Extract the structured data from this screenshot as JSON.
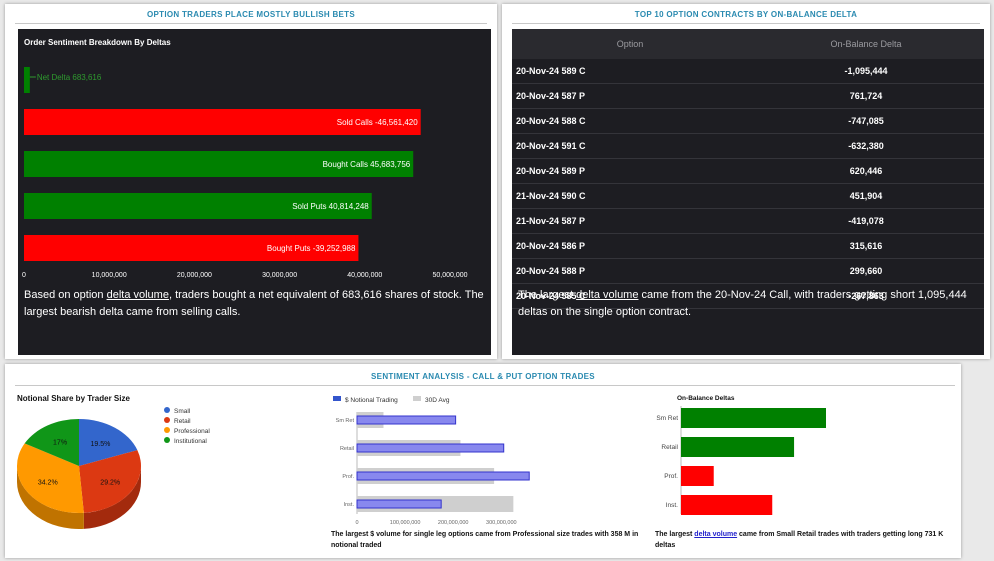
{
  "panels": {
    "left_title": "OPTION TRADERS PLACE MOSTLY BULLISH BETS",
    "right_title": "TOP 10 OPTION CONTRACTS BY ON-BALANCE DELTA",
    "bottom_title": "SENTIMENT ANALYSIS - CALL & PUT OPTION TRADES"
  },
  "order_sentiment": {
    "chart_data": {
      "type": "bar",
      "title": "Order Sentiment Breakdown By Deltas",
      "categories": [
        "Net Delta",
        "Sold Calls",
        "Bought Calls",
        "Sold Puts",
        "Bought Puts"
      ],
      "labels": [
        "Net Delta 683,616",
        "Sold Calls -46,561,420",
        "Bought Calls 45,683,756",
        "Sold Puts 40,814,248",
        "Bought Puts -39,252,988"
      ],
      "values": [
        683616,
        46561420,
        45683756,
        40814248,
        39252988
      ],
      "colors": [
        "#008000",
        "#ff0000",
        "#008000",
        "#008000",
        "#ff0000"
      ],
      "xlim": [
        0,
        50000000
      ],
      "xticks": [
        "0",
        "10,000,000",
        "20,000,000",
        "30,000,000",
        "40,000,000",
        "50,000,000"
      ]
    },
    "note_pre": "Based on option ",
    "note_link": "delta volume",
    "note_post": ", traders bought a net equivalent of 683,616 shares of stock. The largest bearish delta came from selling calls."
  },
  "top10": {
    "headers": [
      "Option",
      "On-Balance Delta"
    ],
    "rows": [
      [
        "20-Nov-24 589 C",
        "-1,095,444"
      ],
      [
        "20-Nov-24 587 P",
        "761,724"
      ],
      [
        "20-Nov-24 588 C",
        "-747,085"
      ],
      [
        "20-Nov-24 591 C",
        "-632,380"
      ],
      [
        "20-Nov-24 589 P",
        "620,446"
      ],
      [
        "21-Nov-24 590 C",
        "451,904"
      ],
      [
        "21-Nov-24 587 P",
        "-419,078"
      ],
      [
        "20-Nov-24 586 P",
        "315,616"
      ],
      [
        "20-Nov-24 588 P",
        "299,660"
      ],
      [
        "20-Nov-24 585 C",
        "-267,863"
      ]
    ],
    "note_pre": "The largest ",
    "note_link": "delta volume",
    "note_post": " came from the 20-Nov-24 Call, with traders getting short 1,095,444 deltas on the single option contract."
  },
  "notional_share": {
    "chart_data": {
      "type": "pie",
      "title": "Notional Share by Trader Size",
      "labels": [
        "Small",
        "Retail",
        "Professional",
        "Institutional"
      ],
      "values": [
        19.5,
        29.2,
        34.2,
        17
      ],
      "value_labels": [
        "19.5%",
        "29.2%",
        "34.2%",
        "17%"
      ],
      "colors": [
        "#3366cc",
        "#dc3912",
        "#ff9900",
        "#109618"
      ]
    }
  },
  "notional_trading": {
    "chart_data": {
      "type": "bar",
      "legend": [
        "$ Notional Trading",
        "30D Avg"
      ],
      "categories": [
        "Sm Ret",
        "Retail",
        "Prof.",
        "Inst."
      ],
      "series": [
        {
          "name": "$ Notional Trading",
          "values": [
            205000000,
            305000000,
            358000000,
            175000000
          ],
          "color": "#8888ee"
        },
        {
          "name": "30D Avg",
          "values": [
            55000000,
            215000000,
            285000000,
            325000000
          ],
          "color": "#cfcfcf"
        }
      ],
      "xlim": [
        0,
        370000000
      ],
      "xticks": [
        "0",
        "100,000,000",
        "200,000,000",
        "300,000,000"
      ]
    },
    "note": "The largest $ volume for single leg options came from Professional size trades with 358 M in notional traded"
  },
  "on_balance": {
    "chart_data": {
      "type": "bar",
      "title": "On-Balance Deltas",
      "categories": [
        "Sm Ret",
        "Retail",
        "Prof.",
        "Inst."
      ],
      "values": [
        731000,
        570000,
        165000,
        460000
      ],
      "colors": [
        "#008000",
        "#008000",
        "#ff0000",
        "#ff0000"
      ]
    },
    "note_pre": "The largest ",
    "note_link": "delta volume",
    "note_post": " came from Small Retail trades with traders getting long 731 K deltas"
  }
}
